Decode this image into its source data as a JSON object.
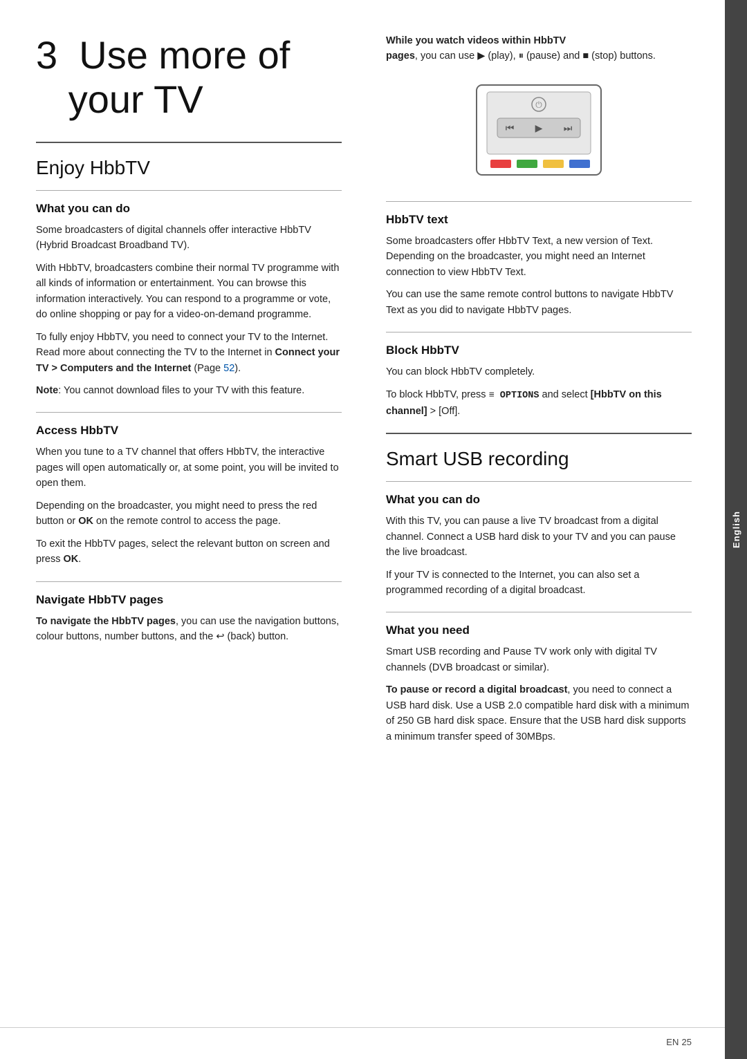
{
  "chapter": {
    "number": "3",
    "title_line1": "Use more of",
    "title_line2": "your TV"
  },
  "side_tab": {
    "label": "English"
  },
  "footer": {
    "lang": "EN",
    "page_number": "25"
  },
  "enjoy_hbbtv": {
    "section_title": "Enjoy HbbTV",
    "what_you_can_do": {
      "heading": "What you can do",
      "para1": "Some broadcasters of digital channels offer interactive HbbTV (Hybrid Broadcast Broadband TV).",
      "para2": "With HbbTV, broadcasters combine their normal TV programme with all kinds of information or entertainment. You can browse this information interactively. You can respond to a programme or vote, do online shopping or pay for a video-on-demand programme.",
      "para3_prefix": "To fully enjoy HbbTV, you need to connect your TV to the Internet. Read more about connecting the TV to the Internet in ",
      "para3_link": "Connect your TV > Computers and the Internet",
      "para3_suffix": " (Page ",
      "para3_page": "52",
      "para3_end": ").",
      "note_prefix": "Note",
      "note_text": ": You cannot download files to your TV with this feature."
    },
    "access_hbbtv": {
      "heading": "Access HbbTV",
      "para1": "When you tune to a TV channel that offers HbbTV, the interactive pages will open automatically or, at some point, you will be invited to open them.",
      "para2_prefix": "Depending on the broadcaster, you might need to press the red button or ",
      "para2_ok": "OK",
      "para2_suffix": " on the remote control to access the page.",
      "para3_prefix": "To exit the HbbTV pages, select the relevant button on screen and press ",
      "para3_ok": "OK",
      "para3_suffix": "."
    },
    "navigate_hbbtv": {
      "heading": "Navigate HbbTV pages",
      "para1_bold": "To navigate the HbbTV pages",
      "para1_suffix": ", you can use the navigation buttons, colour buttons, number buttons, and the",
      "para1_back": " ↩ (back) button."
    },
    "while_watch": {
      "heading": "While you watch videos within HbbTV",
      "para1_bold": "pages",
      "para1_text": ", you can use ▶ (play), ⏸ (pause) and ■ (stop) buttons."
    },
    "hbbtv_text": {
      "heading": "HbbTV text",
      "para1": "Some broadcasters offer HbbTV Text, a new version of Text. Depending on the broadcaster, you might need an Internet connection to view HbbTV Text.",
      "para2": "You can use the same remote control buttons to navigate HbbTV Text as you did to navigate HbbTV pages."
    },
    "block_hbbtv": {
      "heading": "Block HbbTV",
      "para1": "You can block HbbTV completely.",
      "para2_prefix": "To block HbbTV, press ",
      "para2_options": "≡ OPTIONS",
      "para2_middle": " and select ",
      "para2_channel": "[HbbTV on this channel]",
      "para2_suffix": " > [Off]."
    }
  },
  "smart_usb": {
    "section_title": "Smart USB recording",
    "what_you_can_do": {
      "heading": "What you can do",
      "para1": "With this TV, you can pause a live TV broadcast from a digital channel. Connect a USB hard disk to your TV and you can pause the live broadcast.",
      "para2": "If your TV is connected to the Internet, you can also set a programmed recording of a digital broadcast."
    },
    "what_you_need": {
      "heading": "What you need",
      "para1": "Smart USB recording and Pause TV work only with digital TV channels (DVB broadcast or similar).",
      "para2_bold": "To pause or record a digital broadcast",
      "para2_text": ", you need to connect a USB hard disk. Use a USB 2.0 compatible hard disk with a minimum of 250 GB hard disk space. Ensure that the USB hard disk supports a minimum transfer speed of 30MBps."
    }
  }
}
